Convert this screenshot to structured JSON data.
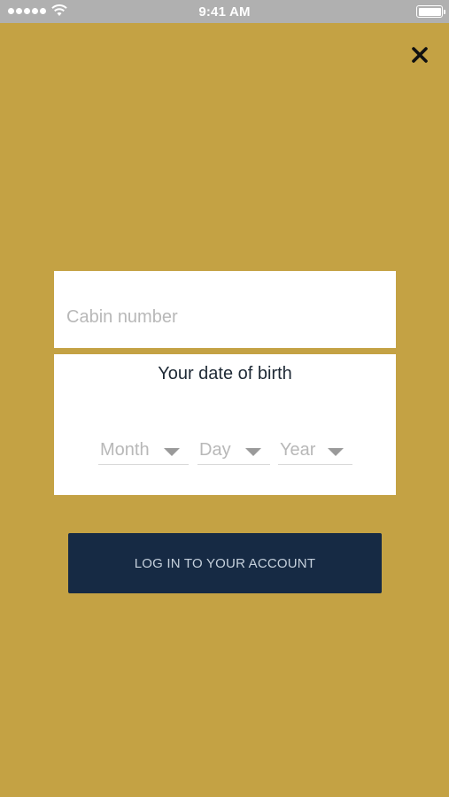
{
  "status_bar": {
    "time": "9:41 AM",
    "signal_icon": "signal-dots-icon",
    "wifi_icon": "wifi-icon",
    "battery_icon": "battery-icon"
  },
  "close": {
    "icon": "close-icon"
  },
  "form": {
    "cabin_placeholder": "Cabin number",
    "cabin_value": "",
    "dob_title": "Your date of birth",
    "month_label": "Month",
    "day_label": "Day",
    "year_label": "Year"
  },
  "login_button": {
    "label": "LOG IN TO YOUR ACCOUNT"
  },
  "colors": {
    "background": "#c4a244",
    "button": "#162a44",
    "status_bar": "#b0b0b0"
  }
}
